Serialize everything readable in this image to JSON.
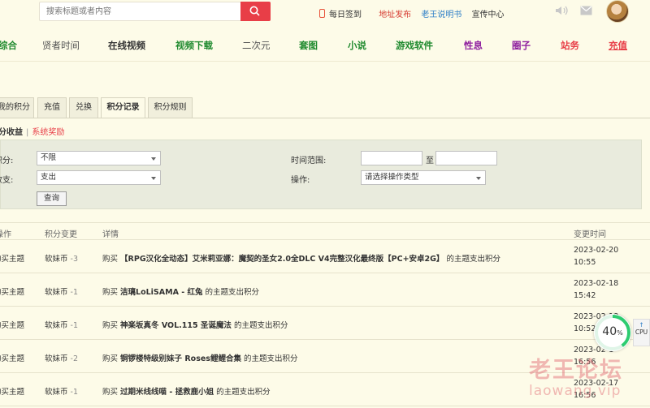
{
  "header": {
    "search_placeholder": "搜索标题或者内容",
    "daily_sign": "每日签到",
    "address_publish": "地址发布",
    "manual": "老王说明书",
    "publicity": "宣传中心"
  },
  "nav": [
    "综合",
    "贤者时间",
    "在线视频",
    "视频下载",
    "二次元",
    "套图",
    "小说",
    "游戏软件",
    "性息",
    "圈子",
    "站务",
    "充值"
  ],
  "tabs": [
    "我的积分",
    "充值",
    "兑换",
    "积分记录",
    "积分规则"
  ],
  "active_tab": "积分记录",
  "subtabs": {
    "active": "积分收益",
    "other": "系统奖励"
  },
  "filter": {
    "type_label": "积分:",
    "type_value": "不限",
    "flow_label": "收支:",
    "flow_value": "支出",
    "time_label": "时间范围:",
    "time_sep": "至",
    "op_label": "操作:",
    "op_value": "请选择操作类型",
    "query_button": "查询"
  },
  "table": {
    "headers": [
      "操作",
      "积分变更",
      "详情",
      "变更时间"
    ],
    "rows": [
      {
        "op": "购买主题",
        "currency": "软妹币",
        "amount": "-3",
        "buy": "购买",
        "title": "【RPG汉化全动态】艾米莉亚娜：魔契的圣女2.0全DLC V4完整汉化最终版【PC+安卓2G】",
        "suffix": "的主题支出积分",
        "date": "2023-02-20",
        "time": "10:55"
      },
      {
        "op": "购买主题",
        "currency": "软妹币",
        "amount": "-1",
        "buy": "购买",
        "title": "洁璃LoLiSAMA - 红兔",
        "suffix": "的主题支出积分",
        "date": "2023-02-18",
        "time": "15:42"
      },
      {
        "op": "购买主题",
        "currency": "软妹币",
        "amount": "-1",
        "buy": "购买",
        "title": "神楽坂真冬 VOL.115 圣诞魔法",
        "suffix": "的主题支出积分",
        "date": "2023-02-18",
        "time": "10:52"
      },
      {
        "op": "购买主题",
        "currency": "软妹币",
        "amount": "-2",
        "buy": "购买",
        "title": "铜锣楼特级别妹子 Roses鲤鲤合集",
        "suffix": "的主题支出积分",
        "date": "2023-02-1",
        "time": "16:56"
      },
      {
        "op": "购买主题",
        "currency": "软妹币",
        "amount": "-1",
        "buy": "购买",
        "title": "过期米线线喵 - 拯救鹿小姐",
        "suffix": "的主题支出积分",
        "date": "2023-02-17",
        "time": "16:56"
      }
    ]
  },
  "overlay": {
    "percent": "40",
    "percent_sign": "%",
    "cpu_label": "CPU",
    "cpu_arrow": "↑"
  },
  "watermark": {
    "line1": "老王论坛",
    "line2": "laowang.vip"
  },
  "colors": {
    "accent": "#e83e47",
    "background": "#fdfbe8",
    "filter_bg": "#e9ebdd",
    "progress_green": "#2ecc71"
  }
}
